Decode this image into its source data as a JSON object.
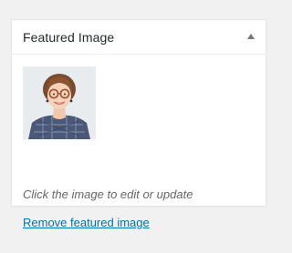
{
  "metabox": {
    "title": "Featured Image",
    "toggle_icon": "triangle-up-icon",
    "image_name": "featured-image-thumbnail",
    "help_text": "Click the image to edit or update",
    "remove_link": "Remove featured image",
    "colors": {
      "link": "#0073aa",
      "title": "#23282d",
      "help": "#666666"
    }
  }
}
